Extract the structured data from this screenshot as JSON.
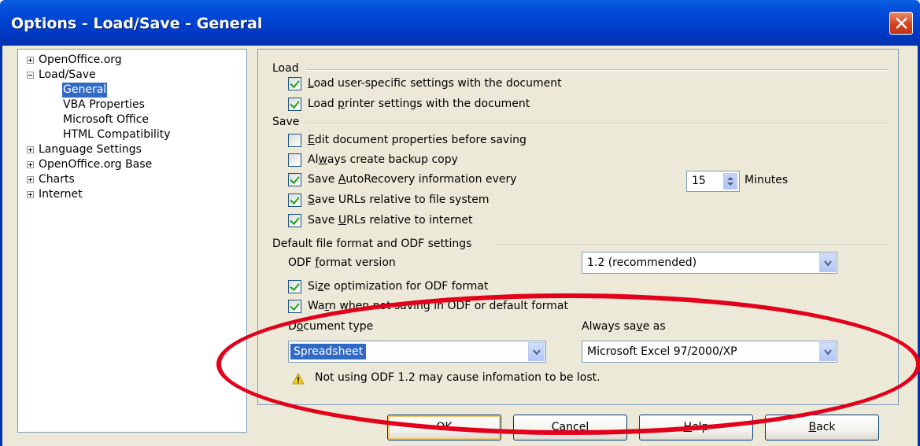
{
  "window": {
    "title": "Options - Load/Save - General",
    "close_icon": "close-icon"
  },
  "tree": {
    "items": [
      {
        "label": "OpenOffice.org",
        "expander": "plus"
      },
      {
        "label": "Load/Save",
        "expander": "minus"
      },
      {
        "label": "General",
        "selected": true
      },
      {
        "label": "VBA Properties"
      },
      {
        "label": "Microsoft Office"
      },
      {
        "label": "HTML Compatibility"
      },
      {
        "label": "Language Settings",
        "expander": "plus"
      },
      {
        "label": "OpenOffice.org Base",
        "expander": "plus"
      },
      {
        "label": "Charts",
        "expander": "plus"
      },
      {
        "label": "Internet",
        "expander": "plus"
      }
    ]
  },
  "load": {
    "heading": "Load",
    "user_settings": {
      "pre": "",
      "u": "L",
      "post": "oad user-specific settings with the document",
      "checked": true
    },
    "printer_settings": {
      "pre": "Load ",
      "u": "p",
      "post": "rinter settings with the document",
      "checked": true
    }
  },
  "save": {
    "heading": "Save",
    "edit_props": {
      "pre": "",
      "u": "E",
      "post": "dit document properties before saving",
      "checked": false
    },
    "backup": {
      "pre": "Al",
      "u": "w",
      "post": "ays create backup copy",
      "checked": false
    },
    "autorecovery": {
      "pre": "Save ",
      "u": "A",
      "post": "utoRecovery information every",
      "checked": true
    },
    "autorecovery_value": "15",
    "autorecovery_unit": "Minutes",
    "urls_fs": {
      "pre": "",
      "u": "S",
      "post": "ave URLs relative to file system",
      "checked": true
    },
    "urls_inet": {
      "pre": "Save ",
      "u": "U",
      "post": "RLs relative to internet",
      "checked": true
    }
  },
  "defaults": {
    "heading": "Default file format and ODF settings",
    "odf_version": {
      "pre": "ODF ",
      "u": "f",
      "post": "ormat version"
    },
    "odf_version_value": "1.2 (recommended)",
    "size_opt": {
      "pre": "Si",
      "u": "z",
      "post": "e optimization for ODF format",
      "checked": true
    },
    "warn": {
      "pre": "Wa",
      "u": "r",
      "post": "n when not saving in ODF or default format",
      "checked": true
    },
    "doc_type": {
      "pre": "D",
      "u": "o",
      "post": "cument type"
    },
    "doc_type_value": "Spreadsheet",
    "always_save": {
      "pre": "Always sa",
      "u": "v",
      "post": "e as"
    },
    "always_save_value": "Microsoft Excel 97/2000/XP",
    "warning_text": "Not using ODF 1.2 may cause infomation to be lost.",
    "warning_icon": "warning-icon"
  },
  "buttons": {
    "ok": {
      "pre": "OK",
      "u": "",
      "post": ""
    },
    "cancel": {
      "pre": "Cancel",
      "u": "",
      "post": ""
    },
    "help": {
      "pre": "",
      "u": "H",
      "post": "elp"
    },
    "back": {
      "pre": "",
      "u": "B",
      "post": "ack"
    }
  },
  "annotation": {
    "color": "#e3001a",
    "shape": "ellipse"
  }
}
